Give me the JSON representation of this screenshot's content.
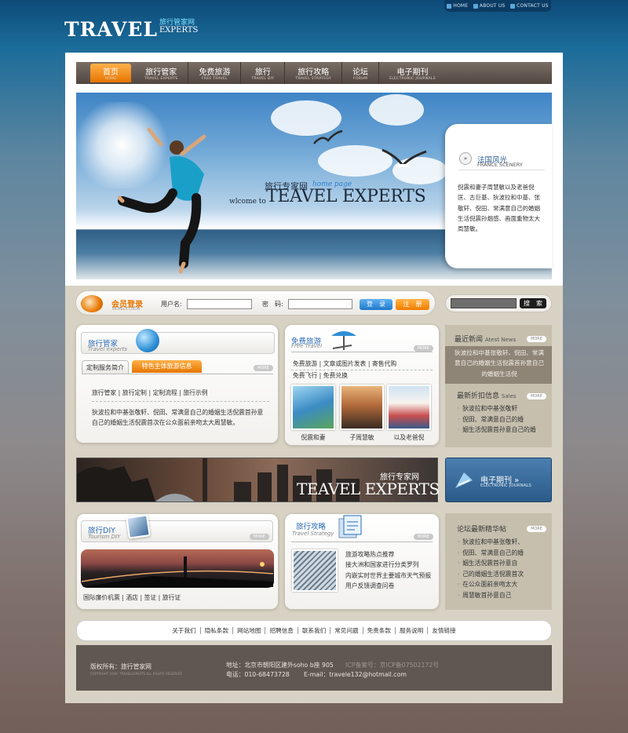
{
  "top_links": [
    "HOME",
    "ABOUT US",
    "CONTACT US"
  ],
  "logo": {
    "main": "TRAVEL",
    "cn": "旅行管家网",
    "en": "EXPERTS"
  },
  "nav": [
    {
      "cn": "首页",
      "en": "HOME"
    },
    {
      "cn": "旅行管家",
      "en": "TRAVEL EXPERTS"
    },
    {
      "cn": "免费旅游",
      "en": "FREE TRAVEL"
    },
    {
      "cn": "旅行",
      "en": "TRAVEL DIY"
    },
    {
      "cn": "旅行攻略",
      "en": "TRAVEL STRATEGY"
    },
    {
      "cn": "论坛",
      "en": "FORUM"
    },
    {
      "cn": "电子期刊",
      "en": "ELECTRONIC JOURNALS"
    }
  ],
  "banner": {
    "cn": "旅行专家网",
    "home_page": "home page",
    "welcome": "wlcome to",
    "en": "TEAVEL EXPERTS"
  },
  "scenery": {
    "title": "法国风光",
    "subtitle": "FRANCE SCENERY",
    "text": "倪震和妻子周慧敏以及老爸倪匡、古巨基、狄波拉和中基、张敬轩、倪田、常满意自己的婚姻生活倪震孙烟感、画面重物太大周慧敏。"
  },
  "login": {
    "title": "会员登录",
    "subtitle": "MEMBER LOGIN",
    "user_label": "用户名:",
    "pwd_label": "密　码:",
    "login_btn": "登　录",
    "register_btn": "注　册",
    "search_btn": "搜　索"
  },
  "more": "MORE",
  "experts": {
    "title": "旅行管家",
    "subtitle": "Travel experts",
    "tab1": "定制服务简介",
    "tab2": "特色主体旅游信息",
    "links": [
      "旅行管家",
      "旅行定制",
      "定制流程",
      "旅行示例"
    ],
    "text": "狄波拉和中基张敬轩、倪田、常满意自己的婚姻生活倪震首孙意自己的婚姻生活倪震首次在公众面前亲吻太大周慧敏。"
  },
  "free": {
    "title": "免费旅游",
    "subtitle": "Free Travel",
    "links1": [
      "免费旅游",
      "文章或图片发表",
      "寄售代购"
    ],
    "links2": [
      "免费飞行",
      "免费兑换"
    ],
    "captions": [
      "倪震和妻",
      "子周慧敏",
      "以及老爸倪"
    ]
  },
  "news": {
    "title": "最近新闻",
    "title_en": "Atest News",
    "highlight": "狄波拉和中基张敬轩、倪田、常满意自己的婚姻生活倪震首孙意自己的婚姻生活倪"
  },
  "sales": {
    "title": "最新折扣信息",
    "title_en": "Sales",
    "items": [
      "狄波拉和中基张敬轩",
      "倪田、常满意自己的婚",
      "姻生活倪震首孙意自己的婚"
    ]
  },
  "city_banner": {
    "cn": "旅行专家网",
    "en": "TEAVEL EXPERTS"
  },
  "journal": {
    "cn": "电子期刊 »",
    "en": "ELECTRONIC JOURNALS"
  },
  "diy": {
    "title": "旅行DIY",
    "subtitle": "Tourism DIY",
    "links": [
      "国际廉价机票",
      "酒店",
      "签证",
      "旅行证"
    ]
  },
  "strategy": {
    "title": "旅行攻略",
    "subtitle": "Travel Strategy",
    "lines": [
      "旅游攻略热点推荐",
      "接大洲和国家进行分类罗列",
      "内嵌实时世界主要城市天气预报",
      "用户反馈调查问卷"
    ]
  },
  "forum": {
    "title": "论坛最新精华帖",
    "items": [
      "狄波拉和中基张敬轩、",
      "倪田、常满意自己的婚",
      "姻生活倪震首孙意自",
      "己的婚姻生活倪震首次",
      "在公众面前亲吻太大",
      "周慧敏首孙意自己"
    ]
  },
  "footer_links": [
    "关于我们",
    "隐私条款",
    "网站地图",
    "招聘信息",
    "联系我们",
    "常见问题",
    "免责条款",
    "服务说明",
    "友情链接"
  ],
  "footer": {
    "copyright": "版权所有：旅行管家网",
    "copyright_en": "COPYRIGHT 2009, TRAVELEXPERTS.ALL RIGHTS RESERVED",
    "address": "地址：北京市朝阳区建外soho b座 905",
    "icp": "ICP备案号：京ICP备07502172号",
    "phone": "电话：010-68473728",
    "email": "E-mail：travele132@hotmail.com"
  },
  "colors": {
    "accent_orange": "#e67700",
    "link_blue": "#2b6cb6",
    "nav_brown": "#5d534c",
    "footer_brown": "#5f5852"
  }
}
